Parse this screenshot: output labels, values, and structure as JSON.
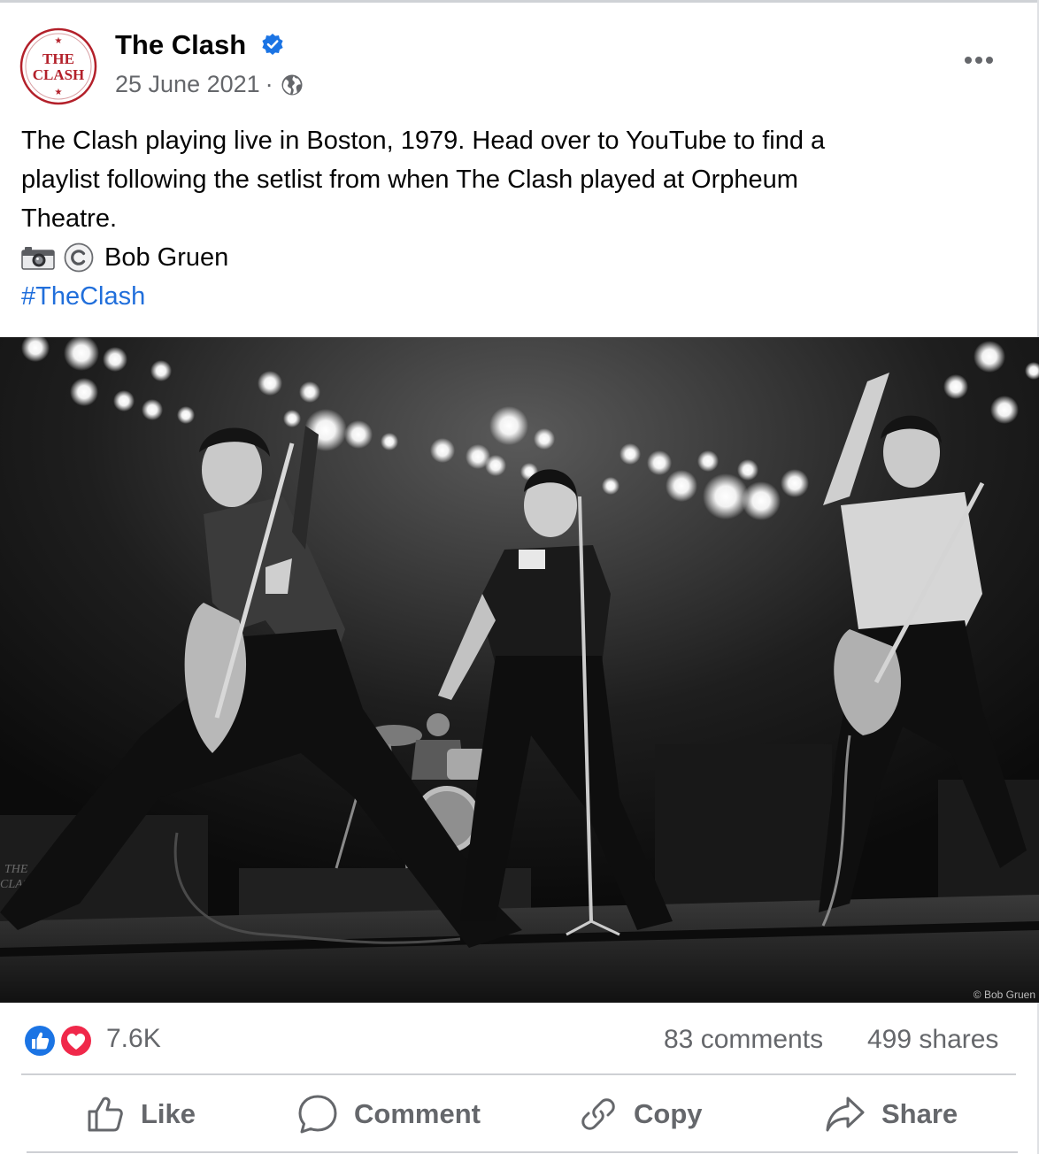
{
  "post": {
    "page_name": "The Clash",
    "verified": true,
    "date": "25 June 2021",
    "meta_separator": "·",
    "audience_icon": "globe-icon",
    "more_icon": "more-options-icon",
    "avatar": {
      "line1": "THE",
      "line2": "CLASH",
      "colors": {
        "ring": "#b3202a",
        "text": "#b3202a"
      }
    },
    "text_lines": [
      "The Clash playing live in Boston, 1979. Head over to YouTube to find a",
      "playlist following the setlist from when The Clash played at Orpheum",
      "Theatre."
    ],
    "credit": {
      "camera_icon": "camera-icon",
      "copyright_icon": "copyright-icon",
      "name": "Bob Gruen"
    },
    "hashtag": "#TheClash",
    "photo": {
      "overlay_credit": "© Bob Gruen",
      "stage_sign": "THE CLASH"
    }
  },
  "stats": {
    "reactions": "7.6K",
    "reaction_icons": [
      "like-reaction-icon",
      "love-reaction-icon"
    ],
    "comments": "83 comments",
    "shares": "499 shares"
  },
  "actions": {
    "like": "Like",
    "comment": "Comment",
    "copy": "Copy",
    "share": "Share"
  },
  "colors": {
    "accent_blue": "#216fdb",
    "muted_text": "#65676b",
    "like_blue": "#1b74e4",
    "love_red": "#f0284a"
  }
}
